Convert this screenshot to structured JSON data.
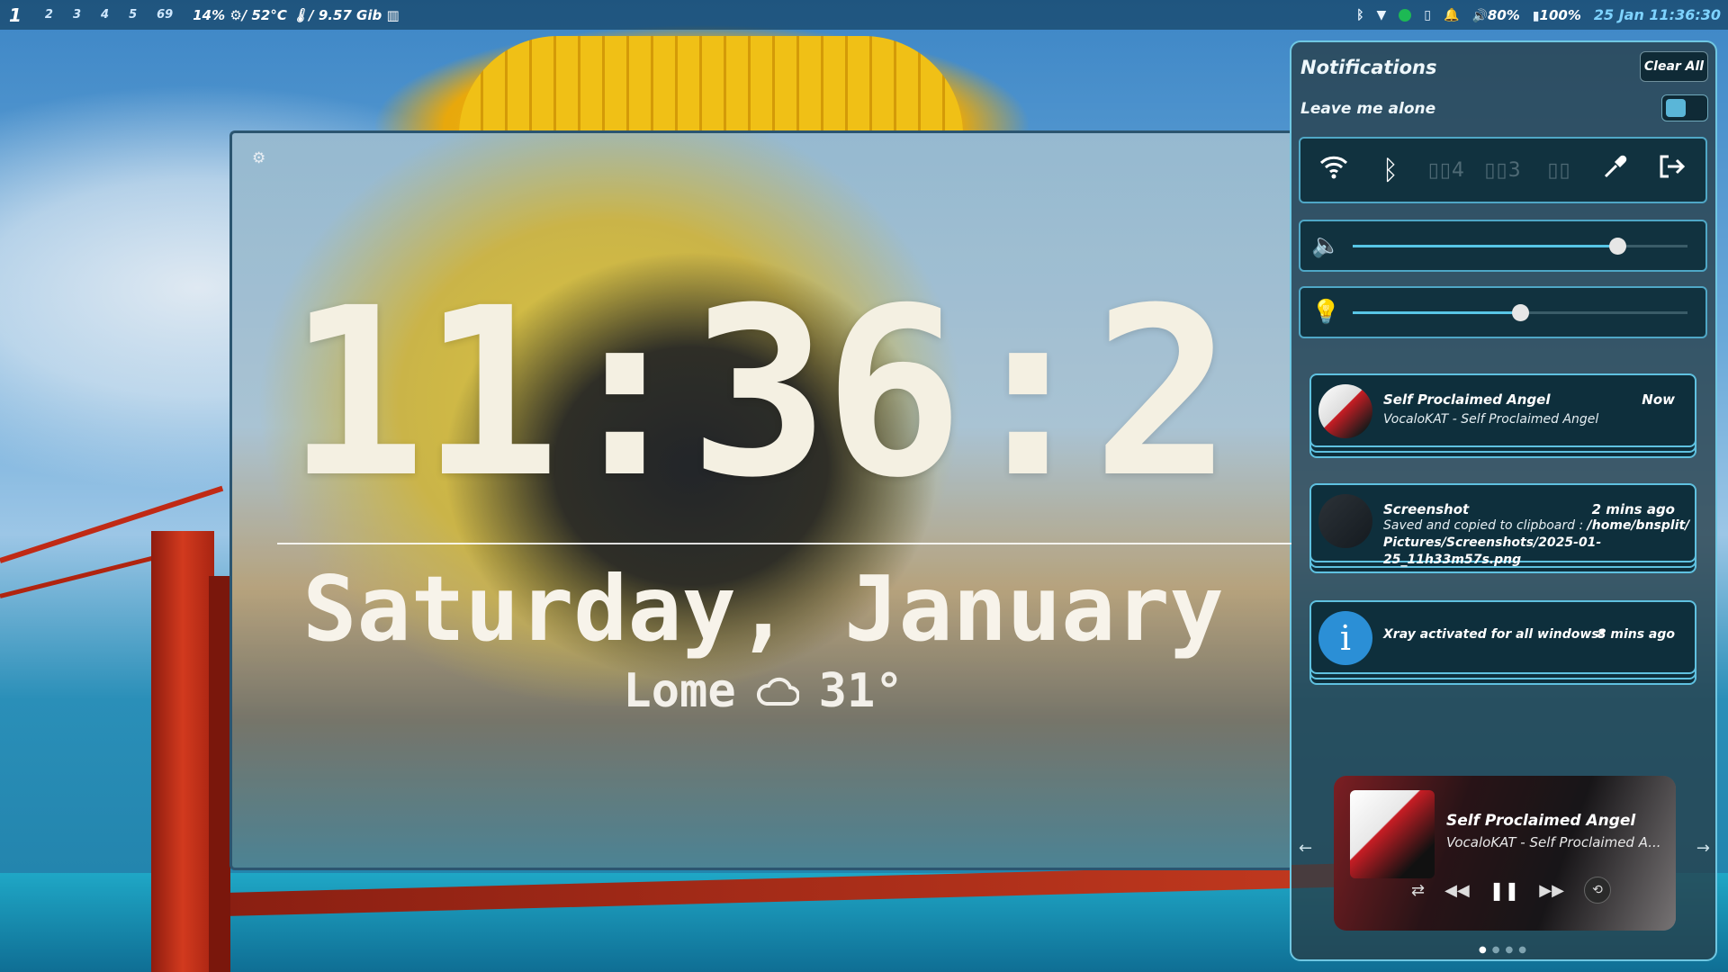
{
  "topbar": {
    "workspaces": [
      "1",
      "2",
      "3",
      "4",
      "5",
      "69"
    ],
    "active_workspace": "1",
    "system_stats": "14% ⚙/ 52°C 🌡/ 9.57 Gib ▥",
    "volume": "80%",
    "battery": "100%",
    "datetime": "25 Jan  11:36:30"
  },
  "clock_widget": {
    "time": "11:36:2",
    "date": "Saturday, January",
    "city": "Lome",
    "temperature": "31°"
  },
  "notifications": {
    "title": "Notifications",
    "clear_all": "Clear All",
    "dnd_label": "Leave me alone",
    "items": [
      {
        "title": "Self Proclaimed Angel",
        "time": "Now",
        "body": "VocaloKAT - Self Proclaimed Angel"
      },
      {
        "title": "Screenshot",
        "time": "2 mins ago",
        "body_prefix": "Saved and copied to clipboard :",
        "body_path_1": "/home/bnsplit/",
        "body_path_2": "Pictures/Screenshots/2025-01-25_11h33m57s.png"
      },
      {
        "title": "Xray activated for all windows!",
        "time": "8 mins ago"
      }
    ]
  },
  "quick_settings": {
    "ws4_label": "▯▯4",
    "ws3_label": "▯▯3",
    "grid_label": "▯▯"
  },
  "sliders": {
    "volume_level": 0.79,
    "brightness_level": 0.5
  },
  "media": {
    "song": "Self Proclaimed Angel",
    "artist": "VocaloKAT - Self Proclaimed A..."
  },
  "colors": {
    "accent": "#5fc1e0",
    "panel_bg": "#11323f",
    "clock_accent": "#7ed3ff"
  }
}
